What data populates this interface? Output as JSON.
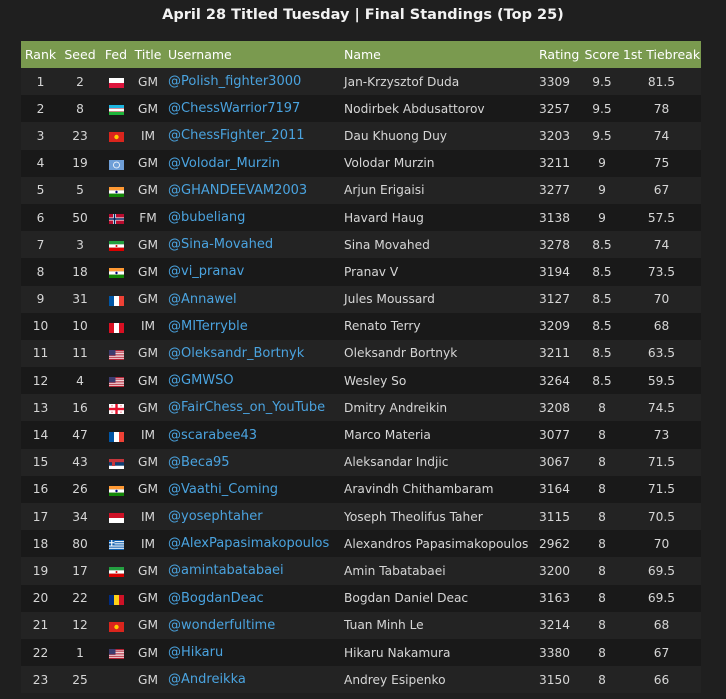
{
  "page": {
    "title": "April 28 Titled Tuesday | Final Standings (Top 25)"
  },
  "table": {
    "headers": [
      "Rank",
      "Seed",
      "Fed",
      "Title",
      "Username",
      "Name",
      "Rating",
      "Score",
      "1st Tiebreak"
    ],
    "rows": [
      {
        "rank": "1",
        "seed": "2",
        "fed": "poland",
        "title": "GM",
        "username": "@Polish_fighter3000",
        "name": "Jan-Krzysztof Duda",
        "rating": "3309",
        "score": "9.5",
        "tiebreak": "81.5"
      },
      {
        "rank": "2",
        "seed": "8",
        "fed": "uzbekistan",
        "title": "GM",
        "username": "@ChessWarrior7197",
        "name": "Nodirbek Abdusattorov",
        "rating": "3257",
        "score": "9.5",
        "tiebreak": "78"
      },
      {
        "rank": "3",
        "seed": "23",
        "fed": "vietnam",
        "title": "IM",
        "username": "@ChessFighter_2011",
        "name": "Dau Khuong Duy",
        "rating": "3203",
        "score": "9.5",
        "tiebreak": "74"
      },
      {
        "rank": "4",
        "seed": "19",
        "fed": "fide",
        "title": "GM",
        "username": "@Volodar_Murzin",
        "name": "Volodar Murzin",
        "rating": "3211",
        "score": "9",
        "tiebreak": "75"
      },
      {
        "rank": "5",
        "seed": "5",
        "fed": "india",
        "title": "GM",
        "username": "@GHANDEEVAM2003",
        "name": "Arjun Erigaisi",
        "rating": "3277",
        "score": "9",
        "tiebreak": "67"
      },
      {
        "rank": "6",
        "seed": "50",
        "fed": "norway",
        "title": "FM",
        "username": "@bubeliang",
        "name": "Havard Haug",
        "rating": "3138",
        "score": "9",
        "tiebreak": "57.5"
      },
      {
        "rank": "7",
        "seed": "3",
        "fed": "iran",
        "title": "GM",
        "username": "@Sina-Movahed",
        "name": "Sina Movahed",
        "rating": "3278",
        "score": "8.5",
        "tiebreak": "74"
      },
      {
        "rank": "8",
        "seed": "18",
        "fed": "india",
        "title": "GM",
        "username": "@vi_pranav",
        "name": "Pranav V",
        "rating": "3194",
        "score": "8.5",
        "tiebreak": "73.5"
      },
      {
        "rank": "9",
        "seed": "31",
        "fed": "france",
        "title": "GM",
        "username": "@Annawel",
        "name": "Jules Moussard",
        "rating": "3127",
        "score": "8.5",
        "tiebreak": "70"
      },
      {
        "rank": "10",
        "seed": "10",
        "fed": "peru",
        "title": "IM",
        "username": "@MITerryble",
        "name": "Renato Terry",
        "rating": "3209",
        "score": "8.5",
        "tiebreak": "68"
      },
      {
        "rank": "11",
        "seed": "11",
        "fed": "usa",
        "title": "GM",
        "username": "@Oleksandr_Bortnyk",
        "name": "Oleksandr Bortnyk",
        "rating": "3211",
        "score": "8.5",
        "tiebreak": "63.5"
      },
      {
        "rank": "12",
        "seed": "4",
        "fed": "usa",
        "title": "GM",
        "username": "@GMWSO",
        "name": "Wesley So",
        "rating": "3264",
        "score": "8.5",
        "tiebreak": "59.5"
      },
      {
        "rank": "13",
        "seed": "16",
        "fed": "georgia",
        "title": "GM",
        "username": "@FairChess_on_YouTube",
        "name": "Dmitry Andreikin",
        "rating": "3208",
        "score": "8",
        "tiebreak": "74.5"
      },
      {
        "rank": "14",
        "seed": "47",
        "fed": "france",
        "title": "IM",
        "username": "@scarabee43",
        "name": "Marco Materia",
        "rating": "3077",
        "score": "8",
        "tiebreak": "73"
      },
      {
        "rank": "15",
        "seed": "43",
        "fed": "serbia",
        "title": "GM",
        "username": "@Beca95",
        "name": "Aleksandar Indjic",
        "rating": "3067",
        "score": "8",
        "tiebreak": "71.5"
      },
      {
        "rank": "16",
        "seed": "26",
        "fed": "india",
        "title": "GM",
        "username": "@Vaathi_Coming",
        "name": "Aravindh Chithambaram",
        "rating": "3164",
        "score": "8",
        "tiebreak": "71.5"
      },
      {
        "rank": "17",
        "seed": "34",
        "fed": "indonesia",
        "title": "IM",
        "username": "@yosephtaher",
        "name": "Yoseph Theolifus Taher",
        "rating": "3115",
        "score": "8",
        "tiebreak": "70.5"
      },
      {
        "rank": "18",
        "seed": "80",
        "fed": "greece",
        "title": "IM",
        "username": "@AlexPapasimakopoulos",
        "name": "Alexandros Papasimakopoulos",
        "rating": "2962",
        "score": "8",
        "tiebreak": "70"
      },
      {
        "rank": "19",
        "seed": "17",
        "fed": "iran",
        "title": "GM",
        "username": "@amintabatabaei",
        "name": "Amin Tabatabaei",
        "rating": "3200",
        "score": "8",
        "tiebreak": "69.5"
      },
      {
        "rank": "20",
        "seed": "22",
        "fed": "romania",
        "title": "GM",
        "username": "@BogdanDeac",
        "name": "Bogdan Daniel Deac",
        "rating": "3163",
        "score": "8",
        "tiebreak": "69.5"
      },
      {
        "rank": "21",
        "seed": "12",
        "fed": "vietnam",
        "title": "GM",
        "username": "@wonderfultime",
        "name": "Tuan Minh Le",
        "rating": "3214",
        "score": "8",
        "tiebreak": "68"
      },
      {
        "rank": "22",
        "seed": "1",
        "fed": "usa",
        "title": "GM",
        "username": "@Hikaru",
        "name": "Hikaru Nakamura",
        "rating": "3380",
        "score": "8",
        "tiebreak": "67"
      },
      {
        "rank": "23",
        "seed": "25",
        "fed": "none",
        "title": "GM",
        "username": "@Andreikka",
        "name": "Andrey Esipenko",
        "rating": "3150",
        "score": "8",
        "tiebreak": "66"
      }
    ]
  }
}
